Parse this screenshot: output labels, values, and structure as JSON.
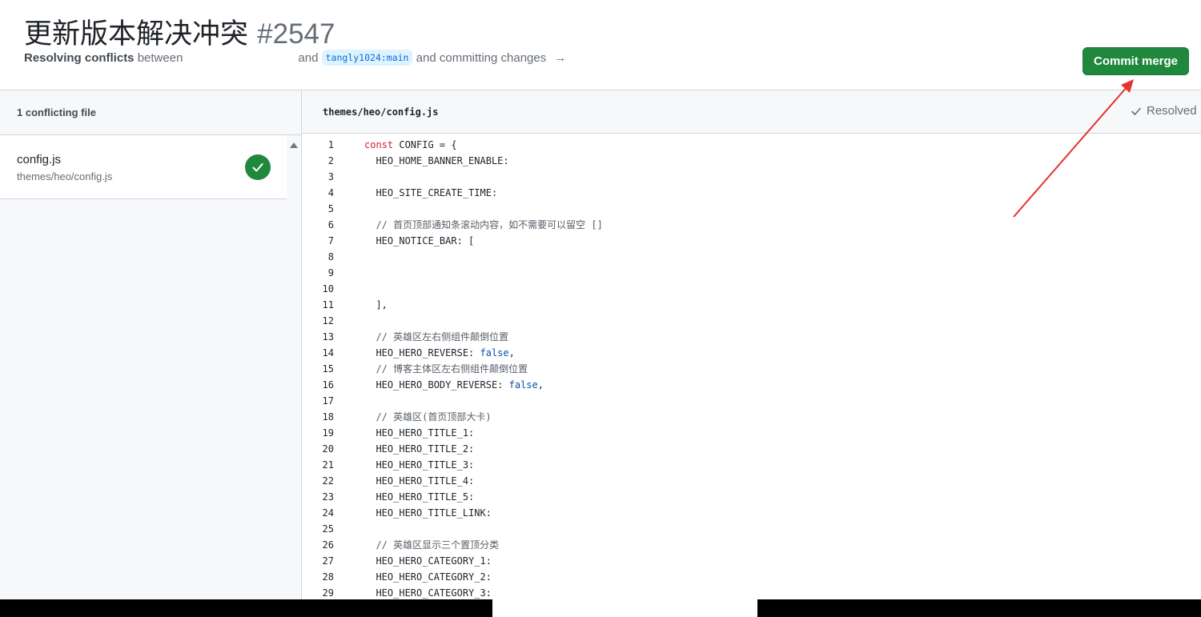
{
  "header": {
    "title": "更新版本解决冲突",
    "number": "#2547",
    "subtitle_strong": "Resolving conflicts",
    "subtitle_between": " between",
    "subtitle_and": "and",
    "branch": "tangly1024:main",
    "subtitle_tail": "and committing changes",
    "arrow": "→"
  },
  "toolbar": {
    "commit_label": "Commit merge"
  },
  "sidebar": {
    "header": "1 conflicting file",
    "file": {
      "name": "config.js",
      "path": "themes/heo/config.js"
    }
  },
  "editor": {
    "path": "themes/heo/config.js",
    "resolved_label": "Resolved",
    "lines": [
      {
        "n": "1",
        "t": "const CONFIG = {"
      },
      {
        "n": "2",
        "t": "  HEO_HOME_BANNER_ENABLE:"
      },
      {
        "n": "3",
        "t": ""
      },
      {
        "n": "4",
        "t": "  HEO_SITE_CREATE_TIME:"
      },
      {
        "n": "5",
        "t": ""
      },
      {
        "n": "6",
        "t": "  // 首页顶部通知条滚动内容，如不需要可以留空 []"
      },
      {
        "n": "7",
        "t": "  HEO_NOTICE_BAR: ["
      },
      {
        "n": "8",
        "t": ""
      },
      {
        "n": "9",
        "t": ""
      },
      {
        "n": "10",
        "t": ""
      },
      {
        "n": "11",
        "t": "  ],"
      },
      {
        "n": "12",
        "t": ""
      },
      {
        "n": "13",
        "t": "  // 英雄区左右侧组件颠倒位置"
      },
      {
        "n": "14",
        "t": "  HEO_HERO_REVERSE: false,"
      },
      {
        "n": "15",
        "t": "  // 博客主体区左右侧组件颠倒位置"
      },
      {
        "n": "16",
        "t": "  HEO_HERO_BODY_REVERSE: false,"
      },
      {
        "n": "17",
        "t": ""
      },
      {
        "n": "18",
        "t": "  // 英雄区(首页顶部大卡)"
      },
      {
        "n": "19",
        "t": "  HEO_HERO_TITLE_1:"
      },
      {
        "n": "20",
        "t": "  HEO_HERO_TITLE_2:"
      },
      {
        "n": "21",
        "t": "  HEO_HERO_TITLE_3:"
      },
      {
        "n": "22",
        "t": "  HEO_HERO_TITLE_4:"
      },
      {
        "n": "23",
        "t": "  HEO_HERO_TITLE_5:"
      },
      {
        "n": "24",
        "t": "  HEO_HERO_TITLE_LINK:"
      },
      {
        "n": "25",
        "t": ""
      },
      {
        "n": "26",
        "t": "  // 英雄区显示三个置顶分类"
      },
      {
        "n": "27",
        "t": "  HEO_HERO_CATEGORY_1:"
      },
      {
        "n": "28",
        "t": "  HEO_HERO_CATEGORY_2:"
      },
      {
        "n": "29",
        "t": "  HEO_HERO_CATEGORY_3:"
      }
    ]
  },
  "colors": {
    "accent_green": "#1f883d",
    "branch_blue": "#0969da",
    "annotation_red": "#e5322d"
  },
  "icons": {
    "check": "check-icon",
    "arrow_right": "arrow-right-icon",
    "scroll_up": "scroll-up-arrow-icon"
  }
}
